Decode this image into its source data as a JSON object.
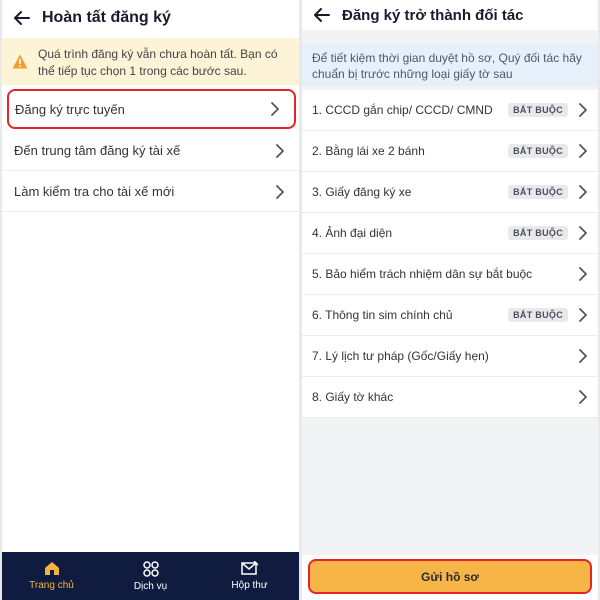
{
  "left": {
    "title": "Hoàn tất đăng ký",
    "warning": "Quá trình đăng ký vẫn chưa hoàn tất. Bạn có thể tiếp tục chọn 1 trong các bước sau.",
    "items": [
      {
        "label": "Đăng ký trực tuyến"
      },
      {
        "label": "Đến trung tâm đăng ký tài xế"
      },
      {
        "label": "Làm kiểm tra cho tài xế mới"
      }
    ],
    "nav": [
      {
        "label": "Trang chủ"
      },
      {
        "label": "Dịch vụ"
      },
      {
        "label": "Hộp thư"
      }
    ]
  },
  "right": {
    "title": "Đăng ký trở thành đối tác",
    "info": "Để tiết kiệm thời gian duyệt hồ sơ, Quý đối tác hãy chuẩn bị trước những loại giấy tờ sau",
    "required_label": "BẮT BUỘC",
    "items": [
      {
        "label": "1. CCCD gắn chip/ CCCD/ CMND",
        "required": true
      },
      {
        "label": "2. Bằng lái xe 2 bánh",
        "required": true
      },
      {
        "label": "3. Giấy đăng ký xe",
        "required": true
      },
      {
        "label": "4. Ảnh đại diện",
        "required": true
      },
      {
        "label": "5. Bảo hiểm trách nhiệm dân sự bắt buộc",
        "required": false
      },
      {
        "label": "6. Thông tin sim chính chủ",
        "required": true
      },
      {
        "label": "7. Lý lịch tư pháp (Gốc/Giấy hẹn)",
        "required": false
      },
      {
        "label": "8. Giấy tờ khác",
        "required": false
      }
    ],
    "submit_label": "Gửi hồ sơ"
  },
  "colors": {
    "accent": "#f7b447",
    "highlight": "#e5242a",
    "nav_bg": "#0f1c3f",
    "warning_bg": "#fdf3d6",
    "info_bg": "#e6f0fb"
  }
}
